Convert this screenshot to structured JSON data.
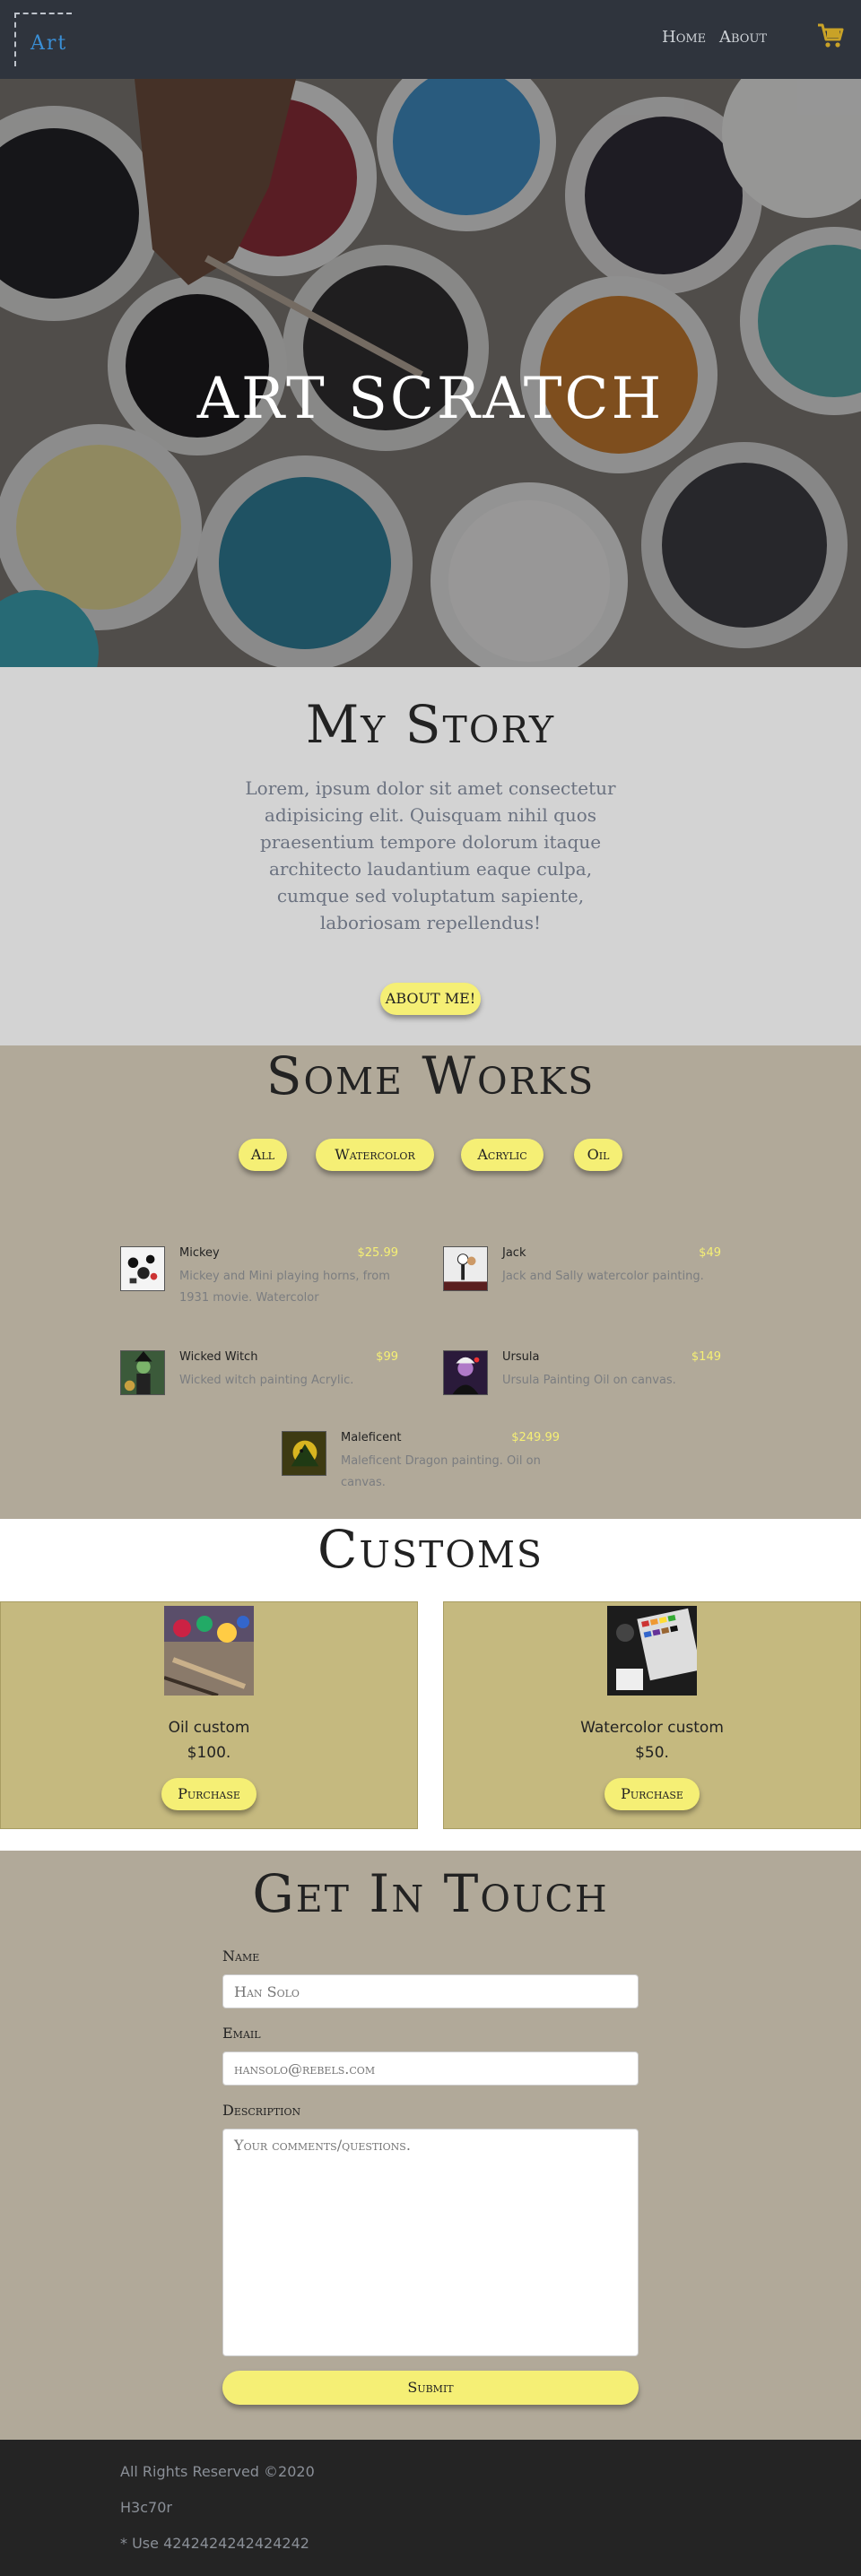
{
  "nav": {
    "logo_text": "Art",
    "links": [
      {
        "label": "Home"
      },
      {
        "label": "About"
      }
    ],
    "cart_icon": "shopping-cart-icon"
  },
  "hero": {
    "title": "ART SCRATCH"
  },
  "story": {
    "title": "My Story",
    "text": "Lorem, ipsum dolor sit amet consectetur adipisicing elit. Quisquam nihil quos praesentium tempore dolorum itaque architecto laudantium eaque culpa, cumque sed voluptatum sapiente, laboriosam repellendus!",
    "button_label": "ABOUT ME!"
  },
  "works": {
    "title": "Some Works",
    "filters": [
      {
        "label": "All"
      },
      {
        "label": "Watercolor"
      },
      {
        "label": "Acrylic"
      },
      {
        "label": "Oil"
      }
    ],
    "items": [
      {
        "name": "Mickey",
        "price": "$25.99",
        "description": "Mickey and Mini playing horns, from 1931 movie. Watercolor"
      },
      {
        "name": "Jack",
        "price": "$49",
        "description": "Jack and Sally watercolor painting."
      },
      {
        "name": "Wicked Witch",
        "price": "$99",
        "description": "Wicked witch painting Acrylic."
      },
      {
        "name": "Ursula",
        "price": "$149",
        "description": "Ursula Painting Oil on canvas."
      },
      {
        "name": "Maleficent",
        "price": "$249.99",
        "description": "Maleficent Dragon painting. Oil on canvas."
      }
    ]
  },
  "customs": {
    "title": "Customs",
    "cards": [
      {
        "title": "Oil custom",
        "price": "$100.",
        "button_label": "Purchase"
      },
      {
        "title": "Watercolor custom",
        "price": "$50.",
        "button_label": "Purchase"
      }
    ]
  },
  "contact": {
    "title": "Get In Touch",
    "name_label": "Name",
    "name_placeholder": "Han Solo",
    "email_label": "Email",
    "email_placeholder": "hansolo@rebels.com",
    "description_label": "Description",
    "description_placeholder": "Your comments/questions.",
    "submit_label": "Submit"
  },
  "footer": {
    "line1": "All Rights Reserved ©2020",
    "line2": "H3c70r",
    "line3": "* Use 4242424242424242"
  },
  "colors": {
    "nav_bg": "#2f343d",
    "accent_yellow": "#f5ef75",
    "section_tan": "#b1a999",
    "card_gold": "#c5b97f",
    "story_gray": "#d3d3d3",
    "footer_bg": "#242424",
    "logo_blue": "#3a8fd6"
  }
}
